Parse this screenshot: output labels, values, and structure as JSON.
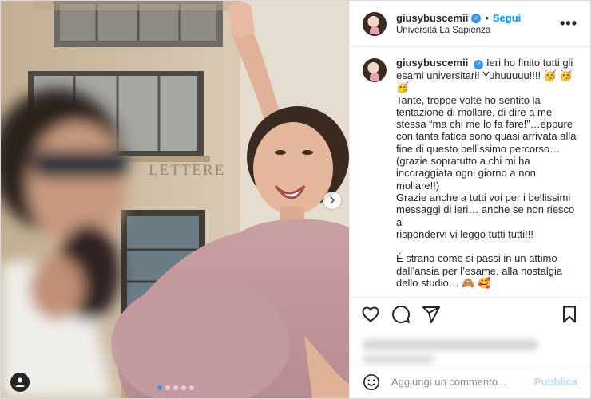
{
  "header": {
    "username": "giusybuscemii",
    "separator": "•",
    "follow_label": "Segui",
    "location": "Università La Sapienza",
    "more": "•••"
  },
  "photo": {
    "wall_sign": "LETTERE",
    "carousel_count": 5,
    "carousel_active": 1
  },
  "caption": {
    "username": "giusybuscemii",
    "text": "Ieri ho finito tutti gli esami universitari! Yuhuuuuu!!!! 🥳 🥳 🥳\nTante, troppe volte ho sentito la tentazione di mollare, di dire a me stessa “ma chi me lo fa fare!”…eppure con tanta fatica sono quasi arrivata alla fine di questo bellissimo percorso… (grazie sopratutto a chi mi ha incoraggiata ogni giorno a non mollare!!)\nGrazie anche a tutti voi per i bellissimi messaggi di ieri… anche se non riesco a\nrispondervi vi leggo tutti tutti!!!\n\nÉ strano come si passi in un attimo dall’ansia per l’esame, alla nostalgia dello studio… 🙈 🥰"
  },
  "actions": {
    "icons": [
      "heart-icon",
      "comment-icon",
      "share-icon",
      "bookmark-icon"
    ]
  },
  "comment": {
    "placeholder": "Aggiungi un commento...",
    "publish_label": "Pubblica"
  },
  "colors": {
    "accent": "#0095f6",
    "verified": "#3897f0",
    "publish_disabled": "#b2dffc"
  }
}
